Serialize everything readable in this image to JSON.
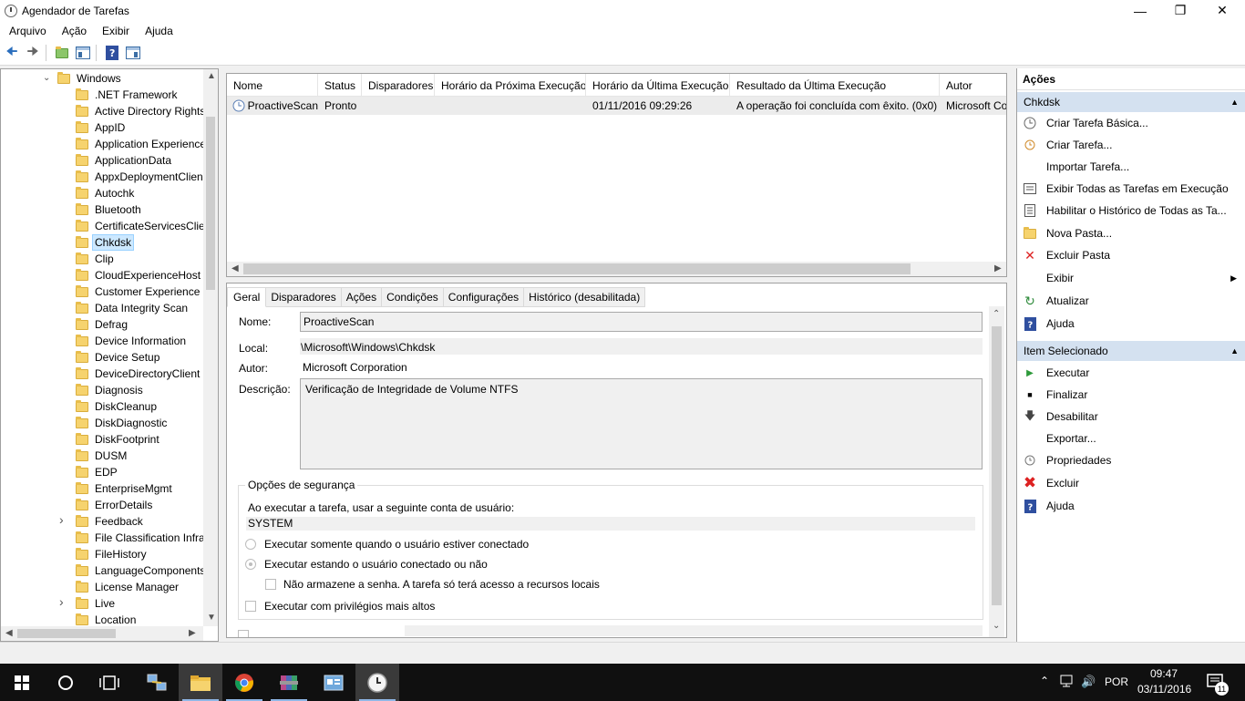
{
  "window": {
    "title": "Agendador de Tarefas"
  },
  "menu": [
    "Arquivo",
    "Ação",
    "Exibir",
    "Ajuda"
  ],
  "tree": {
    "root": "Windows",
    "items": [
      ".NET Framework",
      "Active Directory Rights",
      "AppID",
      "Application Experience",
      "ApplicationData",
      "AppxDeploymentClien",
      "Autochk",
      "Bluetooth",
      "CertificateServicesClien",
      "Chkdsk",
      "Clip",
      "CloudExperienceHost",
      "Customer Experience I",
      "Data Integrity Scan",
      "Defrag",
      "Device Information",
      "Device Setup",
      "DeviceDirectoryClient",
      "Diagnosis",
      "DiskCleanup",
      "DiskDiagnostic",
      "DiskFootprint",
      "DUSM",
      "EDP",
      "EnterpriseMgmt",
      "ErrorDetails",
      "Feedback",
      "File Classification Infra",
      "FileHistory",
      "LanguageComponents",
      "License Manager",
      "Live",
      "Location"
    ],
    "selected": "Chkdsk"
  },
  "task_list": {
    "columns": [
      "Nome",
      "Status",
      "Disparadores",
      "Horário da Próxima Execução",
      "Horário da Última Execução",
      "Resultado da Última Execução",
      "Autor"
    ],
    "rows": [
      {
        "name": "ProactiveScan",
        "status": "Pronto",
        "triggers": "",
        "next_run": "",
        "last_run": "01/11/2016 09:29:26",
        "last_result": "A operação foi concluída com êxito. (0x0)",
        "author": "Microsoft Co"
      }
    ]
  },
  "details": {
    "tabs": [
      "Geral",
      "Disparadores",
      "Ações",
      "Condições",
      "Configurações",
      "Histórico (desabilitada)"
    ],
    "name_label": "Nome:",
    "name_value": "ProactiveScan",
    "location_label": "Local:",
    "location_value": "\\Microsoft\\Windows\\Chkdsk",
    "author_label": "Autor:",
    "author_value": "Microsoft Corporation",
    "description_label": "Descrição:",
    "description_value": "Verificação de Integridade de Volume NTFS",
    "security": {
      "title": "Opções de segurança",
      "account_prompt": "Ao executar a tarefa, usar a seguinte conta de usuário:",
      "account": "SYSTEM",
      "option_logged_on": "Executar somente quando o usuário estiver conectado",
      "option_whether": "Executar estando o usuário conectado ou não",
      "option_no_password": "Não armazene a senha. A tarefa só terá acesso a recursos locais",
      "option_highest": "Executar com privilégios mais altos"
    }
  },
  "actions": {
    "title": "Ações",
    "section1": "Chkdsk",
    "section1_items": [
      "Criar Tarefa Básica...",
      "Criar Tarefa...",
      "Importar Tarefa...",
      "Exibir Todas as Tarefas em Execução",
      "Habilitar o Histórico de Todas as Ta...",
      "Nova Pasta...",
      "Excluir Pasta",
      "Exibir",
      "Atualizar",
      "Ajuda"
    ],
    "section2": "Item Selecionado",
    "section2_items": [
      "Executar",
      "Finalizar",
      "Desabilitar",
      "Exportar...",
      "Propriedades",
      "Excluir",
      "Ajuda"
    ]
  },
  "taskbar": {
    "language": "POR",
    "time": "09:47",
    "date": "03/11/2016",
    "notifications": "11"
  }
}
